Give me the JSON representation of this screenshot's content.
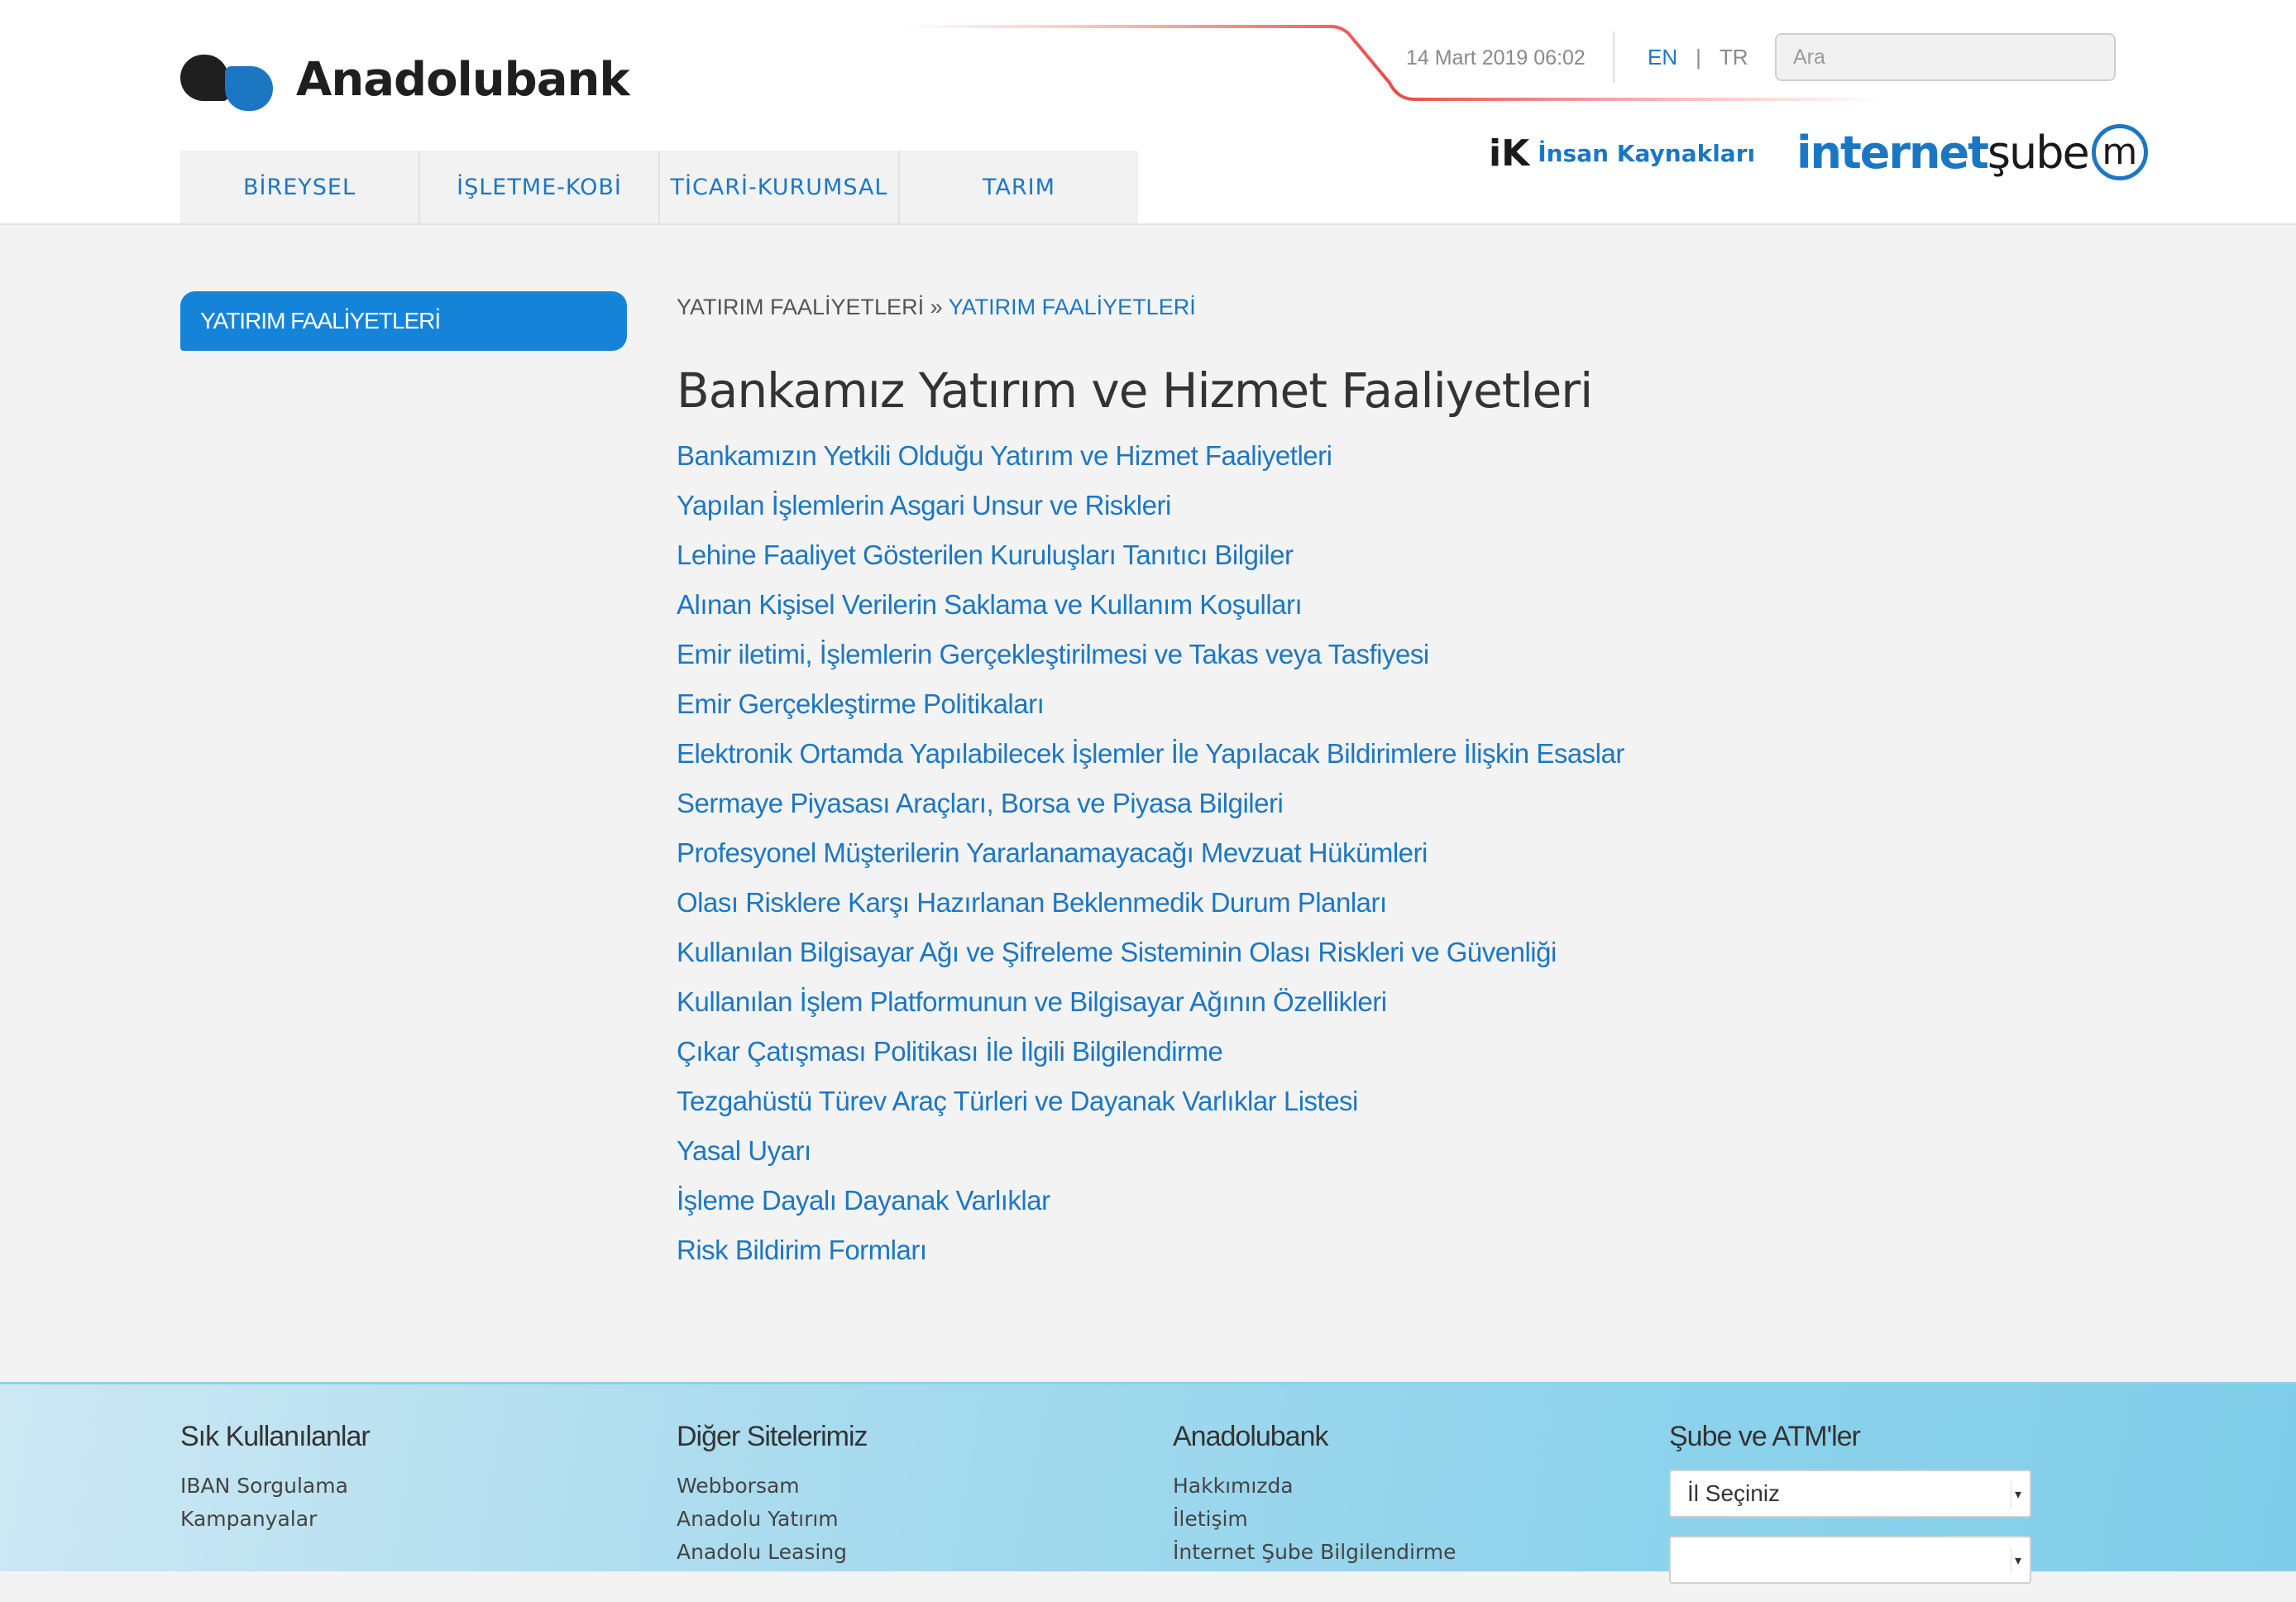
{
  "header": {
    "logo_text": "Anadolubank",
    "date": "14 Mart 2019 06:02",
    "lang": {
      "en": "EN",
      "separator": "|",
      "tr": "TR"
    },
    "search_placeholder": "Ara",
    "ik": {
      "logo": "iK",
      "label": "İnsan Kaynakları"
    },
    "internet_sube": {
      "part1": "internet",
      "part2": "şube",
      "badge": "m"
    },
    "accent_color": "#1c77c3"
  },
  "topnav": {
    "tabs": [
      "BİREYSEL",
      "İŞLETME-KOBİ",
      "TİCARİ-KURUMSAL",
      "TARIM"
    ]
  },
  "sidebar": {
    "items": [
      {
        "label": "YATIRIM FAALİYETLERİ"
      }
    ]
  },
  "breadcrumb": {
    "root": "YATIRIM FAALİYETLERİ",
    "separator": "»",
    "current": "YATIRIM FAALİYETLERİ"
  },
  "main": {
    "title": "Bankamız Yatırım ve Hizmet Faaliyetleri",
    "links": [
      "Bankamızın Yetkili Olduğu Yatırım ve Hizmet Faaliyetleri",
      "Yapılan İşlemlerin Asgari Unsur ve Riskleri",
      "Lehine Faaliyet Gösterilen Kuruluşları Tanıtıcı Bilgiler",
      "Alınan Kişisel Verilerin Saklama ve Kullanım Koşulları",
      "Emir iletimi, İşlemlerin Gerçekleştirilmesi ve Takas veya Tasfiyesi",
      "Emir Gerçekleştirme Politikaları",
      "Elektronik Ortamda Yapılabilecek İşlemler İle Yapılacak Bildirimlere İlişkin Esaslar",
      "Sermaye Piyasası Araçları, Borsa ve Piyasa Bilgileri",
      "Profesyonel Müşterilerin Yararlanamayacağı Mevzuat Hükümleri",
      "Olası Risklere Karşı Hazırlanan Beklenmedik Durum Planları",
      "Kullanılan Bilgisayar Ağı ve Şifreleme Sisteminin Olası Riskleri ve Güvenliği",
      "Kullanılan İşlem Platformunun ve Bilgisayar Ağının Özellikleri",
      "Çıkar Çatışması Politikası İle İlgili Bilgilendirme",
      "Tezgahüstü Türev Araç Türleri ve Dayanak Varlıklar Listesi",
      "Yasal Uyarı",
      "İşleme Dayalı Dayanak Varlıklar",
      "Risk Bildirim Formları"
    ]
  },
  "footer": {
    "col1": {
      "title": "Sık Kullanılanlar",
      "links": [
        "IBAN Sorgulama",
        "Kampanyalar"
      ]
    },
    "col2": {
      "title": "Diğer Sitelerimiz",
      "links": [
        "Webborsam",
        "Anadolu Yatırım",
        "Anadolu Leasing"
      ]
    },
    "col3": {
      "title": "Anadolubank",
      "links": [
        "Hakkımızda",
        "İletişim",
        "İnternet Şube Bilgilendirme"
      ]
    },
    "col4": {
      "title": "Şube ve ATM'ler",
      "select1": "İl Seçiniz",
      "select2": ""
    }
  }
}
